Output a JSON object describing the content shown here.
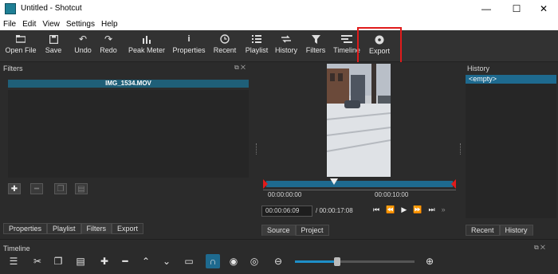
{
  "window": {
    "title": "Untitled - Shotcut",
    "minimize": "—",
    "maximize": "☐",
    "close": "✕"
  },
  "menu": [
    "File",
    "Edit",
    "View",
    "Settings",
    "Help"
  ],
  "toolbar": {
    "open_file": "Open File",
    "save": "Save",
    "undo": "Undo",
    "redo": "Redo",
    "peak_meter": "Peak Meter",
    "properties": "Properties",
    "recent": "Recent",
    "playlist": "Playlist",
    "history": "History",
    "filters": "Filters",
    "timeline": "Timeline",
    "export": "Export"
  },
  "filters_panel": {
    "title": "Filters",
    "clip_name": "IMG_1534.MOV",
    "buttons": {
      "add": "✚",
      "remove": "━"
    }
  },
  "left_tabs": [
    "Properties",
    "Playlist",
    "Filters",
    "Export"
  ],
  "player": {
    "ruler_start": "00:00:00:00",
    "ruler_mid": "00:00:10:00",
    "current_time": "00:00:06:09",
    "total_time": "/ 00:00:17:08",
    "tabs": [
      "Source",
      "Project"
    ]
  },
  "history_panel": {
    "title": "History",
    "items": [
      "<empty>"
    ],
    "tabs": [
      "Recent",
      "History"
    ]
  },
  "timeline": {
    "title": "Timeline",
    "zoom_level": 0.35
  },
  "colors": {
    "accent": "#1f5f78",
    "highlight": "#e01b1b",
    "selected": "#1e6a8f"
  }
}
